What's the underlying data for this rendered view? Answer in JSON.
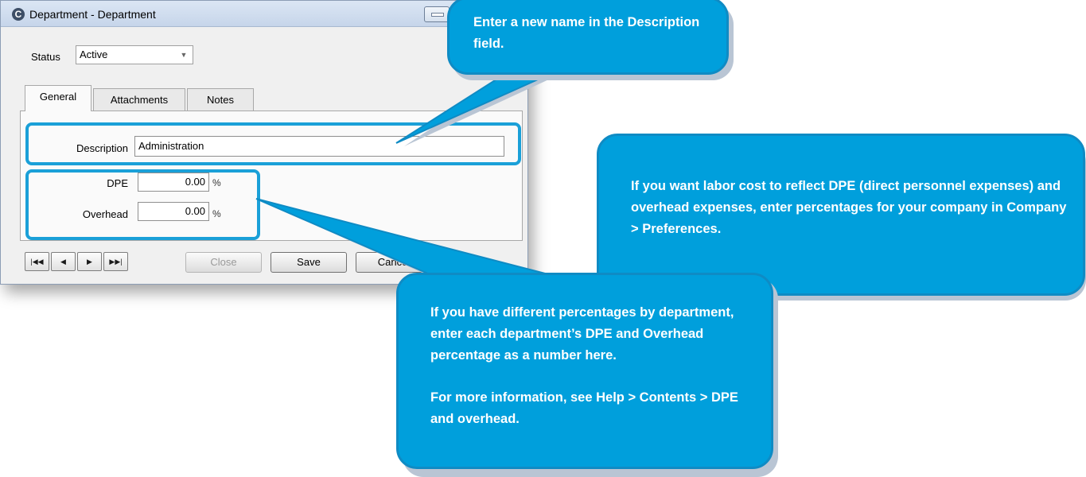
{
  "window": {
    "title": "Department - Department",
    "status_label": "Status",
    "status_value": "Active",
    "tabs": [
      {
        "label": "General",
        "active": true
      },
      {
        "label": "Attachments",
        "active": false
      },
      {
        "label": "Notes",
        "active": false
      }
    ],
    "description_label": "Description",
    "description_value": "Administration",
    "dpe_label": "DPE",
    "dpe_value": "0.00",
    "overhead_label": "Overhead",
    "overhead_value": "0.00",
    "percent_symbol": "%",
    "buttons": {
      "close": "Close",
      "save": "Save",
      "cancel": "Cancel"
    },
    "nav": {
      "first": "first-record-icon",
      "previous": "previous-record-icon",
      "next": "next-record-icon",
      "last": "last-record-icon"
    }
  },
  "callouts": {
    "description_tip": "Enter a new name in the Description field.",
    "preferences_tip": "If you want labor cost to reflect DPE (direct personnel expenses) and overhead expenses, enter percentages for your company in Company > Preferences.",
    "department_tip_1": "If you have different percentages by department, enter each department’s DPE and Overhead percentage as a number here.",
    "department_tip_2": "For more information, see Help > Contents > DPE and overhead."
  },
  "colors": {
    "callout_fill": "#009fdc",
    "highlight_border": "#1aa0d8"
  }
}
